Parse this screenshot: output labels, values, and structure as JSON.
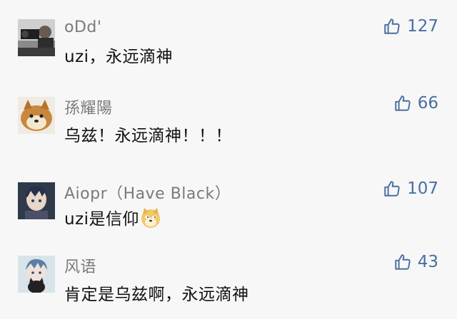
{
  "comments": [
    {
      "username": "oDd'",
      "text": "uzi，永远滴神",
      "likes": "127"
    },
    {
      "username": "孫耀陽",
      "text": "乌兹！永远滴神！！！",
      "likes": "66"
    },
    {
      "username": "Aiopr（Have Black）",
      "text": "uzi是信仰",
      "likes": "107",
      "emoji": "doge-emoji"
    },
    {
      "username": "风语",
      "text": "肯定是乌兹啊，永远滴神",
      "likes": "43"
    }
  ],
  "colors": {
    "background": "#f7f7f7",
    "username": "#7a7a7a",
    "text": "#111111",
    "like_accent": "#4a6fa0"
  },
  "icons": {
    "like": "thumbs-up-icon"
  }
}
